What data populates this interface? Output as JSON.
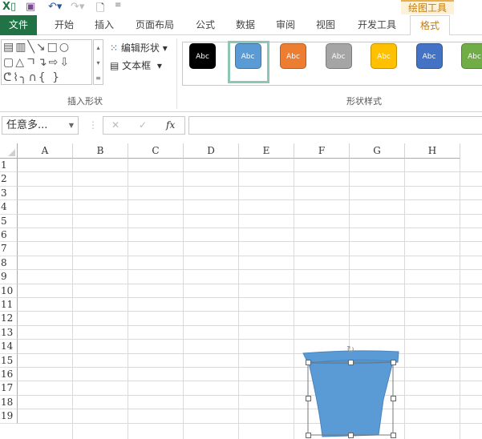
{
  "titlebar": {
    "app_icon": "excel-icon",
    "quick_access": [
      "save-icon",
      "undo-icon",
      "redo-icon",
      "print-preview-icon",
      "customize-icon"
    ],
    "context_tab": "绘图工具"
  },
  "tabs": [
    "文件",
    "开始",
    "插入",
    "页面布局",
    "公式",
    "数据",
    "审阅",
    "视图",
    "开发工具",
    "格式"
  ],
  "active_tab": "格式",
  "ribbon": {
    "insert_shapes": {
      "label": "插入形状",
      "edit_shape": "编辑形状",
      "text_box": "文本框",
      "shape_rows": [
        "▤▥╲↘□○",
        "▢△ㄱ↴⇨⇩",
        "ᕦ⌇╮∩{ }"
      ]
    },
    "shape_styles": {
      "label": "形状样式",
      "swatch_text": "Abc",
      "swatches": [
        "#000000",
        "#5b9bd5",
        "#ed7d31",
        "#a5a5a5",
        "#ffc000",
        "#4472c4",
        "#70ad47"
      ],
      "selected_index": 1
    }
  },
  "formula_bar": {
    "name_box": "任意多...",
    "cancel": "✕",
    "enter": "✓",
    "fx": "fx",
    "value": ""
  },
  "sheet": {
    "columns": [
      "A",
      "B",
      "C",
      "D",
      "E",
      "F",
      "G",
      "H"
    ],
    "rows": [
      "1",
      "2",
      "3",
      "4",
      "5",
      "6",
      "7",
      "8",
      "9",
      "10",
      "11",
      "12",
      "13",
      "14",
      "15",
      "16",
      "17",
      "18",
      "19"
    ]
  },
  "shape": {
    "type": "freeform",
    "fill": "#5b9bd5",
    "selected": true
  }
}
